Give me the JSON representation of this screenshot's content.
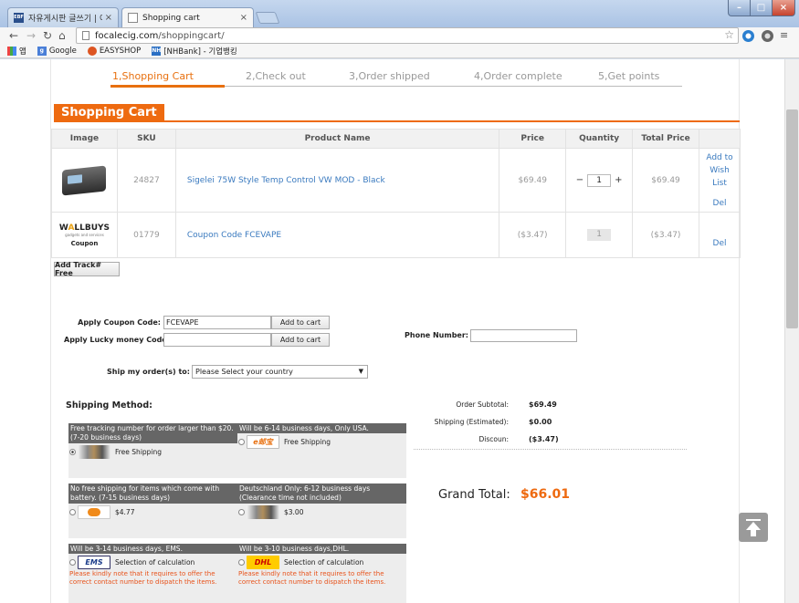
{
  "browser": {
    "tabs": [
      {
        "title": "자유게시판 글쓰기 | 이비",
        "favicon": "EBF"
      },
      {
        "title": "Shopping cart"
      }
    ],
    "url_host": "focalecig.com",
    "url_path": "/shoppingcart/",
    "bookmarks": [
      {
        "label": "앱",
        "icon": "apps-grid-icon"
      },
      {
        "label": "Google",
        "icon": "google-icon"
      },
      {
        "label": "EASYSHOP",
        "icon": "easyshop-icon"
      },
      {
        "label": "[NHBank] - 기업뱅킹",
        "icon": "nh-icon",
        "badge": "NH"
      }
    ]
  },
  "steps": [
    "1,Shopping Cart",
    "2,Check out",
    "3,Order shipped",
    "4,Order complete",
    "5,Get points"
  ],
  "heading": "Shopping Cart",
  "cart": {
    "columns": [
      "Image",
      "SKU",
      "Product Name",
      "Price",
      "Quantity",
      "Total Price",
      ""
    ],
    "items": [
      {
        "sku": "24827",
        "name": "Sigelei 75W Style Temp Control VW MOD - Black",
        "price": "$69.49",
        "qty": "1",
        "total": "$69.49",
        "actions": [
          "Add to",
          "Wish",
          "List",
          "Del"
        ]
      },
      {
        "sku": "01779",
        "name": "Coupon Code FCEVAPE",
        "price": "($3.47)",
        "qty": "1",
        "total": "($3.47)",
        "actions": [
          "Del"
        ],
        "logo": {
          "brand_a": "W",
          "brand_o": "A",
          "brand_b": "LLBUYS",
          "tagline": "gadgets and services",
          "caption": "Coupon"
        }
      }
    ],
    "qty_minus": "−",
    "qty_plus": "+"
  },
  "add_track": "Add Track# Free",
  "coupon": {
    "label": "Apply Coupon Code:",
    "value": "FCEVAPE",
    "button": "Add to cart"
  },
  "lucky": {
    "label": "Apply Lucky money Code:",
    "value": "",
    "button": "Add to cart"
  },
  "phone": {
    "label": "Phone Number:",
    "value": ""
  },
  "ship_to": {
    "label": "Ship my order(s) to:",
    "selected": "Please Select your country"
  },
  "shipping": {
    "title": "Shipping Method:",
    "options": [
      {
        "header": "Free tracking number for order larger than $20. (7-20 business days)",
        "label": "Free Shipping",
        "selected": true
      },
      {
        "header": "Will be 6-14 business days, Only USA.",
        "label": "Free Shipping",
        "logo_text": "e邮宝"
      },
      {
        "header": "No free shipping for items which come with battery. (7-15 business days)",
        "label": "$4.77"
      },
      {
        "header": "Deutschland Only: 6-12 business days (Clearance time not included)",
        "label": "$3.00"
      },
      {
        "header": "Will be 3-14 business days, EMS.",
        "label": "Selection of calculation",
        "logo_text": "EMS",
        "note": "Please kindly note that it requires to offer the correct contact number to dispatch the items."
      },
      {
        "header": "Will be 3-10 business days,DHL.",
        "label": "Selection of calculation",
        "logo_text": "DHL",
        "note": "Please kindly note that it requires to offer the correct contact number to dispatch the items."
      }
    ]
  },
  "summary": {
    "subtotal_label": "Order Subtotal:",
    "subtotal": "$69.49",
    "shipping_label": "Shipping (Estimated):",
    "shipping": "$0.00",
    "discount_label": "Discoun:",
    "discount": "($3.47)",
    "grand_label": "Grand Total:",
    "grand": "$66.01"
  },
  "colors": {
    "accent": "#ee6a10",
    "link": "#3a7abf",
    "note": "#e8521a"
  }
}
